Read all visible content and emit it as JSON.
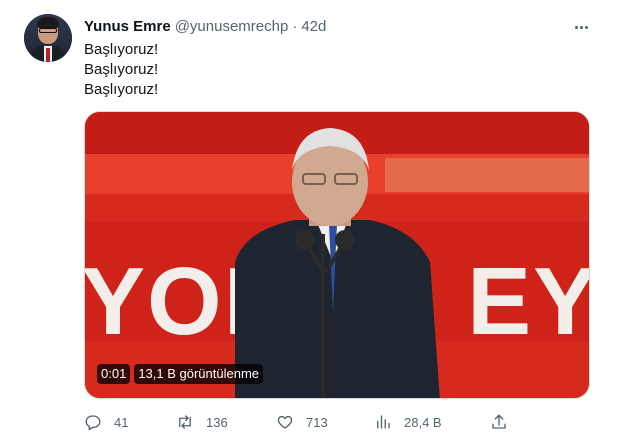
{
  "tweet": {
    "author_name": "Yunus Emre",
    "handle": "@yunusemrechp",
    "separator": "·",
    "time": "42d",
    "lines": [
      "Başlıyoruz!",
      "Başlıyoruz!",
      "Başlıyoruz!"
    ],
    "video": {
      "timestamp": "0:01",
      "views": "13,1 B görüntülenme",
      "banner_text": "YOR      EY D"
    },
    "actions": {
      "replies": "41",
      "retweets": "136",
      "likes": "713",
      "views": "28,4 B"
    }
  },
  "colors": {
    "text_primary": "#0f1419",
    "text_secondary": "#536471",
    "video_red": "#d9241c"
  },
  "icons": {
    "more": "more-dots-icon",
    "reply": "reply-icon",
    "retweet": "retweet-icon",
    "like": "heart-icon",
    "views": "analytics-icon",
    "share": "share-icon"
  }
}
